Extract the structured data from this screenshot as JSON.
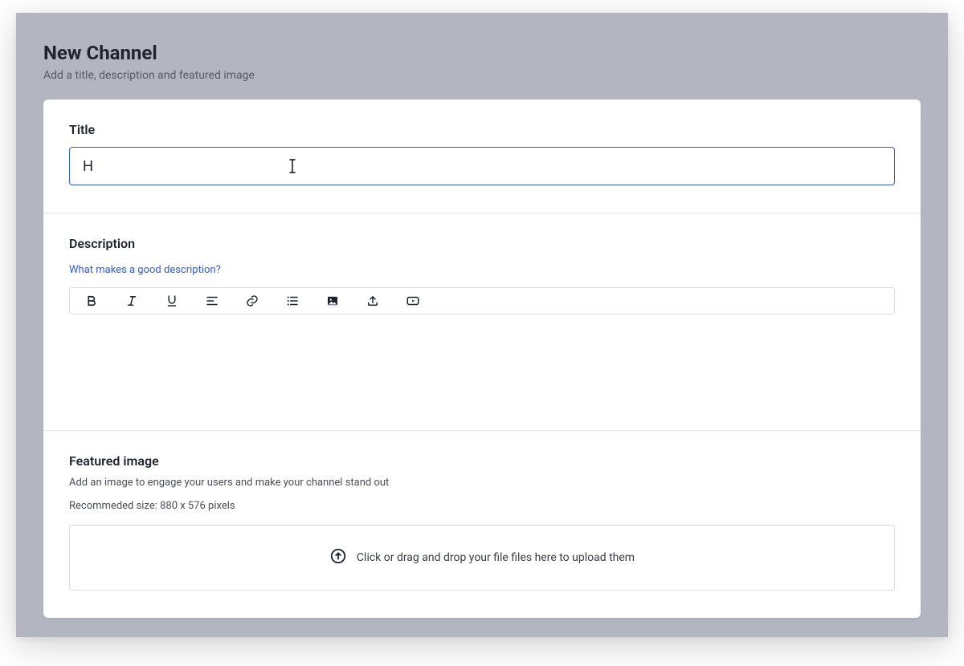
{
  "header": {
    "title": "New Channel",
    "subtitle": "Add a title, description and featured image"
  },
  "titleSection": {
    "label": "Title",
    "value": "H"
  },
  "descriptionSection": {
    "label": "Description",
    "helperLink": "What makes a good description?",
    "toolbar": {
      "bold": "bold",
      "italic": "italic",
      "underline": "underline",
      "align": "align",
      "link": "link",
      "list": "list",
      "image": "image",
      "upload": "upload",
      "video": "video"
    }
  },
  "featuredSection": {
    "label": "Featured image",
    "subtext": "Add an image to engage your users and make your channel stand out",
    "recommended": "Recommeded size: 880 x 576 pixels",
    "dropzoneText": "Click or drag and drop your file files here to upload them"
  }
}
